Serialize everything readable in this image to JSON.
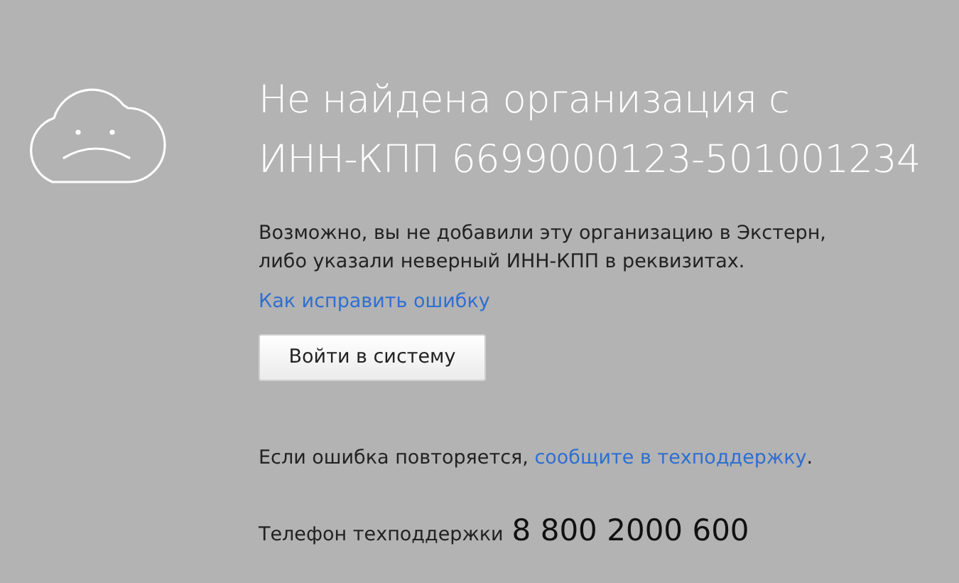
{
  "title_lines": [
    "Не найдена организация с",
    "ИНН-КПП 6699000123-501001234"
  ],
  "message_lines": [
    "Возможно, вы не добавили эту организацию в Экстерн,",
    "либо указали неверный ИНН-КПП в реквизитах."
  ],
  "help_link": "Как исправить ошибку",
  "login_button": "Войти в систему",
  "support": {
    "before": "Если ошибка повторяется, ",
    "link": "сообщите в техподдержку",
    "after": "."
  },
  "phone": {
    "label": "Телефон техподдержки",
    "number": "8 800 2000 600"
  }
}
